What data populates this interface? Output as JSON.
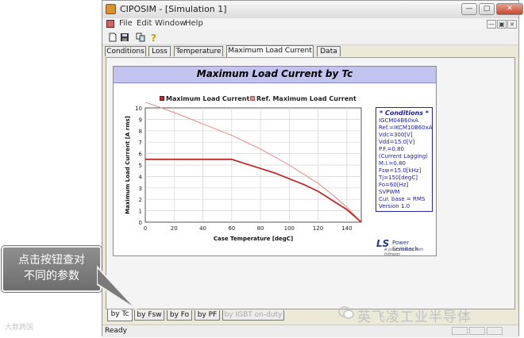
{
  "window": {
    "title": "CIPOSIM - [Simulation 1]"
  },
  "menu": {
    "items": [
      "File",
      "Edit",
      "Window",
      "Help"
    ]
  },
  "toolbar": {
    "icons": [
      "new-icon",
      "save-icon",
      "copy-icon",
      "help-icon"
    ]
  },
  "tabs": [
    {
      "label": "Conditions"
    },
    {
      "label": "Loss"
    },
    {
      "label": "Temperature"
    },
    {
      "label": "Maximum Load Current",
      "active": true
    },
    {
      "label": "Data"
    }
  ],
  "chart_header": {
    "title": "Maximum Load Current by Tc"
  },
  "legend": [
    {
      "label": "Maximum Load Current",
      "color": "#c0282a"
    },
    {
      "label": "Ref. Maximum Load Current",
      "color": "#e88888"
    }
  ],
  "chart_data": {
    "type": "line",
    "title": "Maximum Load Current by Tc",
    "xlabel": "Case Temperature [degC]",
    "ylabel": "Maximum Load Current [A rms]",
    "xlim": [
      0,
      150
    ],
    "ylim": [
      0,
      10
    ],
    "xticks": [
      0,
      20,
      40,
      60,
      80,
      100,
      120,
      140
    ],
    "yticks": [
      0,
      1,
      2,
      3,
      4,
      5,
      6,
      7,
      8,
      9,
      10
    ],
    "grid": true,
    "series": [
      {
        "name": "Maximum Load Current",
        "color": "#c0282a",
        "x": [
          0,
          20,
          40,
          60,
          70,
          80,
          90,
          100,
          110,
          120,
          130,
          140,
          150
        ],
        "y": [
          5.5,
          5.5,
          5.5,
          5.5,
          5.1,
          4.7,
          4.3,
          3.8,
          3.3,
          2.7,
          1.9,
          1.1,
          0
        ]
      },
      {
        "name": "Ref. Maximum Load Current",
        "color": "#e88888",
        "x": [
          0,
          20,
          40,
          60,
          80,
          100,
          120,
          130,
          140,
          150
        ],
        "y": [
          10.5,
          9.6,
          8.6,
          7.6,
          6.4,
          5.0,
          3.4,
          2.4,
          1.3,
          0
        ]
      }
    ]
  },
  "conditions": {
    "title": "* Conditions *",
    "lines": [
      "IGCM04B60xA",
      "Ref.=IKCM10B60xA",
      "Vdc=300[V]",
      "Vdd=15.0[V]",
      "P.F.=0.80",
      "(Current Lagging)",
      "M.I.=0.80",
      "Fsw=15.0[kHz]",
      "Tj=150[degC]",
      "Fo=60[Hz]",
      "SVPWM",
      "Cur. base = RMS",
      "Version 1.0"
    ]
  },
  "logo": {
    "brand": "LS",
    "name": "Power Semitech",
    "tagline": "A joint venture with Infineon"
  },
  "bottom_tabs": [
    {
      "label": "by Tc",
      "active": true
    },
    {
      "label": "by Fsw"
    },
    {
      "label": "by Fo"
    },
    {
      "label": "by PF"
    },
    {
      "label": "by IGBT on-duty",
      "disabled": true
    }
  ],
  "status": {
    "text": "Ready"
  },
  "callout": {
    "line1": "点击按钮查对",
    "line2": "不同的参数"
  },
  "watermarks": {
    "left": "大数跨国",
    "right": "英飞凌工业半导体"
  }
}
